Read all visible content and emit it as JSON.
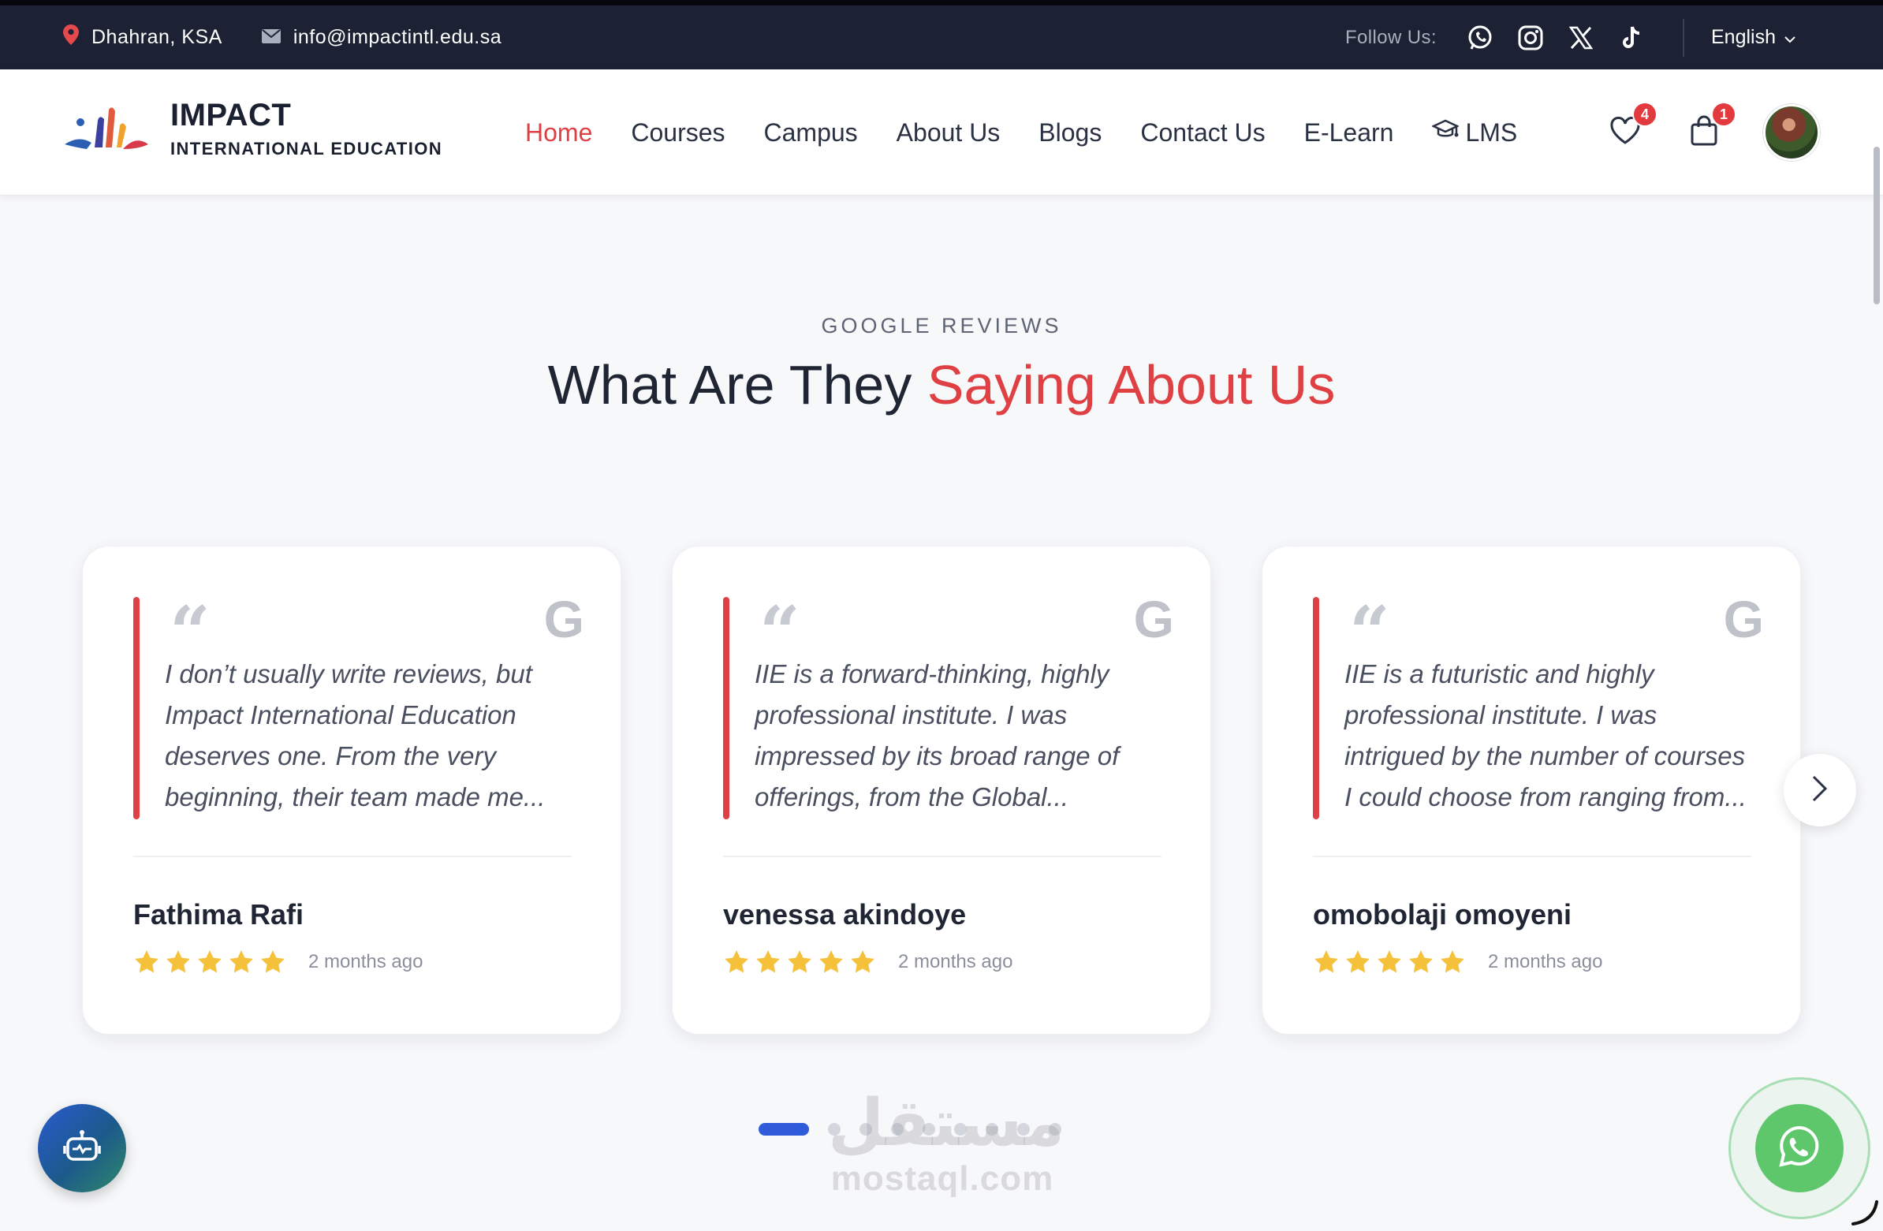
{
  "topbar": {
    "location": "Dhahran, KSA",
    "email": "info@impactintl.edu.sa",
    "follow_label": "Follow Us:",
    "language": "English"
  },
  "header": {
    "logo_name": "IMPACT",
    "logo_sub": "INTERNATIONAL EDUCATION",
    "nav": [
      {
        "label": "Home",
        "active": true
      },
      {
        "label": "Courses"
      },
      {
        "label": "Campus"
      },
      {
        "label": "About Us"
      },
      {
        "label": "Blogs"
      },
      {
        "label": "Contact Us"
      },
      {
        "label": "E-Learn"
      },
      {
        "label": "LMS",
        "icon": "graduation-cap-icon"
      }
    ],
    "wishlist_count": "4",
    "cart_count": "1"
  },
  "section": {
    "eyebrow": "GOOGLE REVIEWS",
    "title_part1": "What Are They",
    "title_accent": "Saying About Us"
  },
  "reviews": [
    {
      "text": "I don’t usually write reviews, but Impact International Education deserves one. From the very beginning, their team made me...",
      "name": "Fathima Rafi",
      "rating": 5,
      "time": "2 months ago"
    },
    {
      "text": "IIE is a forward-thinking, highly professional institute. I was impressed by its broad range of offerings, from the Global...",
      "name": "venessa akindoye",
      "rating": 5,
      "time": "2 months ago"
    },
    {
      "text": "IIE is a futuristic and highly professional institute. I was intrigued by the number of courses I could choose from ranging from...",
      "name": "omobolaji omoyeni",
      "rating": 5,
      "time": "2 months ago"
    }
  ],
  "review_source_glyph": "G",
  "quote_glyph": "“",
  "watermark": {
    "arabic": "مستقل",
    "latin": "mostaql.com"
  },
  "colors": {
    "accent": "#df4044",
    "topbar_bg": "#1c2234",
    "star": "#f5c13b",
    "pagination_active": "#2f5bdb",
    "whatsapp": "#5fc76b"
  }
}
